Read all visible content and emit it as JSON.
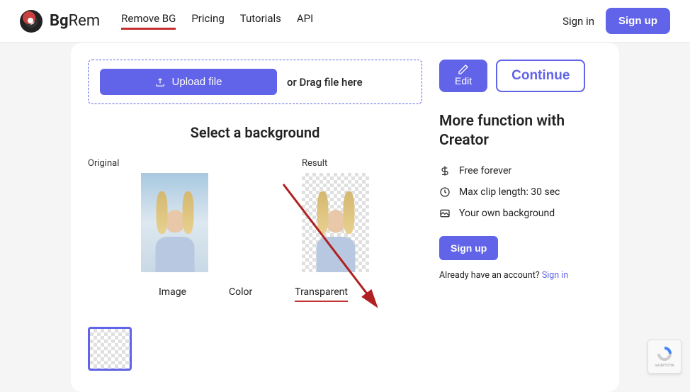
{
  "header": {
    "logo_bold": "Bg",
    "logo_thin": "Rem",
    "nav": [
      "Remove BG",
      "Pricing",
      "Tutorials",
      "API"
    ],
    "active_nav": 0,
    "signin": "Sign in",
    "signup": "Sign up"
  },
  "upload": {
    "button_label": "Upload file",
    "drag_text": "or Drag file here"
  },
  "section": {
    "title": "Select a background",
    "original_label": "Original",
    "result_label": "Result"
  },
  "tabs": [
    "Image",
    "Color",
    "Transparent"
  ],
  "active_tab": 2,
  "actions": {
    "edit": "Edit",
    "continue": "Continue"
  },
  "features": {
    "title": "More function with Creator",
    "items": [
      "Free forever",
      "Max clip length: 30 sec",
      "Your own background"
    ]
  },
  "cta": {
    "signup": "Sign up",
    "account_text": "Already have an account? ",
    "signin": "Sign in"
  },
  "colors": {
    "primary": "#6163e8",
    "accent": "#c43030"
  }
}
